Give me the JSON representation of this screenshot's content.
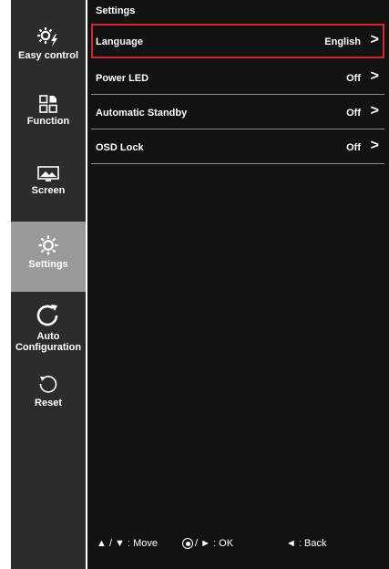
{
  "sidebar": {
    "items": [
      {
        "label": "Easy control",
        "icon": "easy-control-icon"
      },
      {
        "label": "Function",
        "icon": "function-icon"
      },
      {
        "label": "Screen",
        "icon": "screen-icon"
      },
      {
        "label": "Settings",
        "icon": "settings-gear-icon",
        "active": true
      },
      {
        "label": "Auto Configuration",
        "icon": "auto-configuration-icon"
      },
      {
        "label": "Reset",
        "icon": "reset-icon"
      }
    ]
  },
  "main": {
    "title": "Settings",
    "rows": [
      {
        "label": "Language",
        "value": "English",
        "arrow": ">"
      },
      {
        "label": "Power LED",
        "value": "Off",
        "arrow": ">"
      },
      {
        "label": "Automatic Standby",
        "value": "Off",
        "arrow": ">"
      },
      {
        "label": "OSD Lock",
        "value": "Off",
        "arrow": ">"
      }
    ]
  },
  "footer": {
    "move": "▲ / ▼ : Move",
    "ok": "/ ► : OK",
    "back": "◄ : Back"
  },
  "colors": {
    "sidebar_bg": "#2c2c2c",
    "active_bg": "#9a9a9a",
    "main_bg": "#121212",
    "selection_border": "#d6262c"
  }
}
